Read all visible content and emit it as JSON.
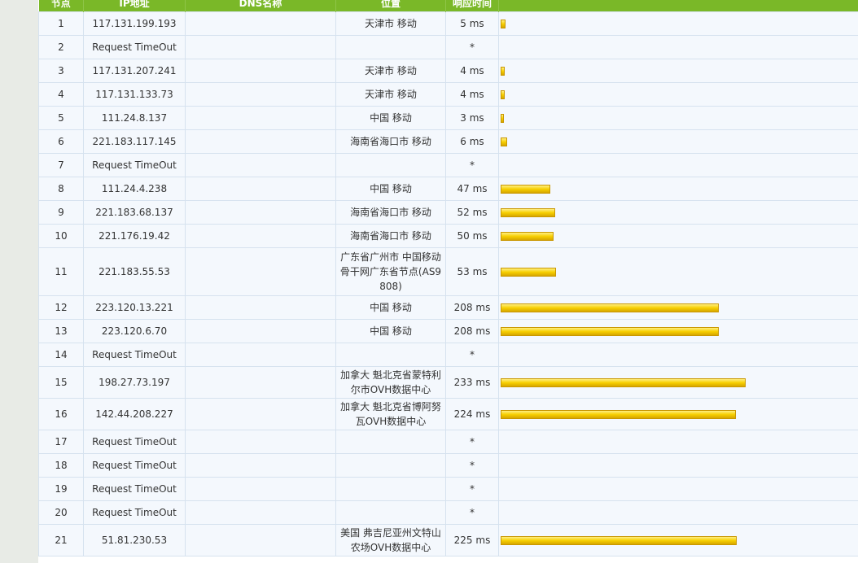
{
  "headers": [
    "节点",
    "IP地址",
    "DNS名称",
    "位置",
    "响应时间",
    ""
  ],
  "colors": {
    "header_bg": "#7ab828",
    "row_bg": "#f4f8fd",
    "bar": "#f7cf00"
  },
  "rows": [
    {
      "hop": "1",
      "ip": "117.131.199.193",
      "dns": "",
      "location": "天津市 移动",
      "time": "5 ms",
      "ms": 5
    },
    {
      "hop": "2",
      "ip": "Request TimeOut",
      "dns": "",
      "location": "",
      "time": "*",
      "ms": 0
    },
    {
      "hop": "3",
      "ip": "117.131.207.241",
      "dns": "",
      "location": "天津市 移动",
      "time": "4 ms",
      "ms": 4
    },
    {
      "hop": "4",
      "ip": "117.131.133.73",
      "dns": "",
      "location": "天津市 移动",
      "time": "4 ms",
      "ms": 4
    },
    {
      "hop": "5",
      "ip": "111.24.8.137",
      "dns": "",
      "location": "中国 移动",
      "time": "3 ms",
      "ms": 3
    },
    {
      "hop": "6",
      "ip": "221.183.117.145",
      "dns": "",
      "location": "海南省海口市 移动",
      "time": "6 ms",
      "ms": 6
    },
    {
      "hop": "7",
      "ip": "Request TimeOut",
      "dns": "",
      "location": "",
      "time": "*",
      "ms": 0
    },
    {
      "hop": "8",
      "ip": "111.24.4.238",
      "dns": "",
      "location": "中国 移动",
      "time": "47 ms",
      "ms": 47
    },
    {
      "hop": "9",
      "ip": "221.183.68.137",
      "dns": "",
      "location": "海南省海口市 移动",
      "time": "52 ms",
      "ms": 52
    },
    {
      "hop": "10",
      "ip": "221.176.19.42",
      "dns": "",
      "location": "海南省海口市 移动",
      "time": "50 ms",
      "ms": 50
    },
    {
      "hop": "11",
      "ip": "221.183.55.53",
      "dns": "",
      "location": "广东省广州市 中国移动骨干网广东省节点(AS9808)",
      "time": "53 ms",
      "ms": 53
    },
    {
      "hop": "12",
      "ip": "223.120.13.221",
      "dns": "",
      "location": "中国 移动",
      "time": "208 ms",
      "ms": 208
    },
    {
      "hop": "13",
      "ip": "223.120.6.70",
      "dns": "",
      "location": "中国 移动",
      "time": "208 ms",
      "ms": 208
    },
    {
      "hop": "14",
      "ip": "Request TimeOut",
      "dns": "",
      "location": "",
      "time": "*",
      "ms": 0
    },
    {
      "hop": "15",
      "ip": "198.27.73.197",
      "dns": "",
      "location": "加拿大 魁北克省蒙特利尔市OVH数据中心",
      "time": "233 ms",
      "ms": 233
    },
    {
      "hop": "16",
      "ip": "142.44.208.227",
      "dns": "",
      "location": "加拿大 魁北克省博阿努瓦OVH数据中心",
      "time": "224 ms",
      "ms": 224
    },
    {
      "hop": "17",
      "ip": "Request TimeOut",
      "dns": "",
      "location": "",
      "time": "*",
      "ms": 0
    },
    {
      "hop": "18",
      "ip": "Request TimeOut",
      "dns": "",
      "location": "",
      "time": "*",
      "ms": 0
    },
    {
      "hop": "19",
      "ip": "Request TimeOut",
      "dns": "",
      "location": "",
      "time": "*",
      "ms": 0
    },
    {
      "hop": "20",
      "ip": "Request TimeOut",
      "dns": "",
      "location": "",
      "time": "*",
      "ms": 0
    },
    {
      "hop": "21",
      "ip": "51.81.230.53",
      "dns": "",
      "location": "美国 弗吉尼亚州文特山农场OVH数据中心",
      "time": "225 ms",
      "ms": 225
    }
  ]
}
